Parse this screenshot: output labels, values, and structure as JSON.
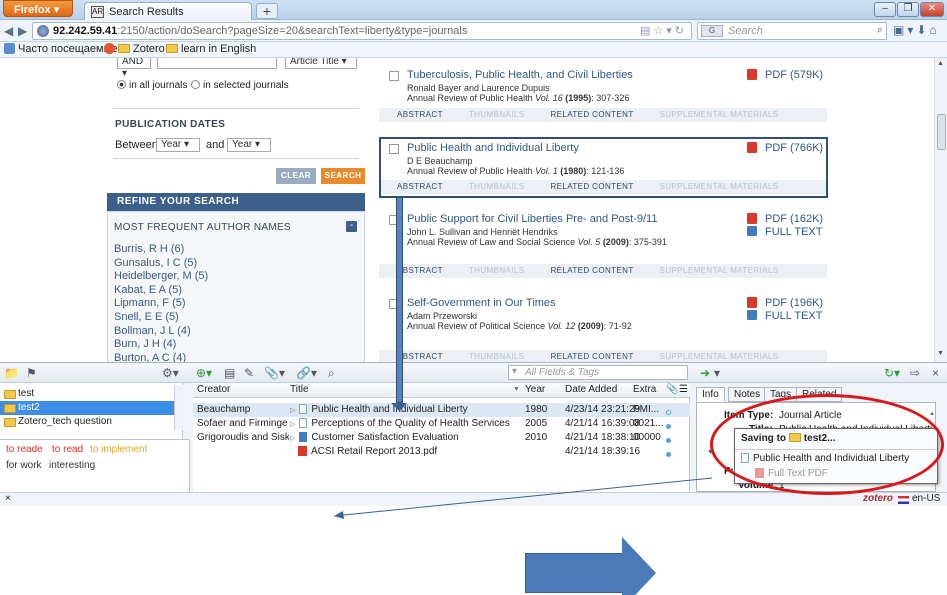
{
  "browser": {
    "app_button": "Firefox",
    "tab_title": "Search Results",
    "new_tab": "+",
    "url_host": "92.242.59.41",
    "url_rest": ":2150/action/doSearch?pageSize=20&searchText=liberty&type=journals",
    "search_placeholder": "Search",
    "search_engine": "G",
    "bookmarks": [
      {
        "label": "Часто посещаемые"
      },
      {
        "label": "Zotero"
      },
      {
        "label": "learn in English"
      }
    ]
  },
  "page": {
    "field_operator": "AND",
    "field_type": "Article Title",
    "scope_all": "in all journals",
    "scope_selected": "in selected journals",
    "dates_heading": "PUBLICATION DATES",
    "between": "Between",
    "year_from": "Year",
    "and": "and",
    "year_to": "Year",
    "clear_label": "CLEAR",
    "search_label": "SEARCH",
    "refine_heading": "REFINE YOUR SEARCH",
    "authors_heading": "MOST FREQUENT AUTHOR NAMES",
    "collapse": "-",
    "authors": [
      "Burris, R H (6)",
      "Gunsalus, I C (5)",
      "Heidelberger, M (5)",
      "Kabat, E A (5)",
      "Lipmann, F (5)",
      "Snell, E E (5)",
      "Bollman, J L (4)",
      "Burn, J H (4)",
      "Burton, A C (4)"
    ],
    "result_tabs": [
      "ABSTRACT",
      "THUMBNAILS",
      "RELATED CONTENT",
      "SUPPLEMENTAL MATERIALS"
    ],
    "results": [
      {
        "title": "Tuberculosis, Public Health, and Civil Liberties",
        "authors": "Ronald Bayer and Laurence Dupuis",
        "cite_pre": "Annual Review of Public Health ",
        "cite_vol": "Vol. 16",
        "cite_year": "(1995)",
        "cite_pages": ": 307-326",
        "pdf": "PDF (579K)",
        "full": ""
      },
      {
        "title": "Public Health and Individual Liberty",
        "authors": "D E Beauchamp",
        "cite_pre": "Annual Review of Public Health ",
        "cite_vol": "Vol. 1",
        "cite_year": "(1980)",
        "cite_pages": ": 121-136",
        "pdf": "PDF (766K)",
        "full": ""
      },
      {
        "title": "Public Support for Civil Liberties Pre- and Post-9/11",
        "authors": "John L. Sullivan and Henriët Hendriks",
        "cite_pre": "Annual Review of Law and Social Science ",
        "cite_vol": "Vol. 5",
        "cite_year": "(2009)",
        "cite_pages": ": 375-391",
        "pdf": "PDF (162K)",
        "full": "FULL TEXT"
      },
      {
        "title": "Self-Government in Our Times",
        "authors": "Adam Przeworski",
        "cite_pre": "Annual Review of Political Science ",
        "cite_vol": "Vol. 12",
        "cite_year": "(2009)",
        "cite_pages": ": 71-92",
        "pdf": "PDF (196K)",
        "full": "FULL TEXT"
      }
    ]
  },
  "zotero": {
    "search_placeholder": "All Fields & Tags",
    "collections": [
      "test",
      "test2",
      "Zotero_tech question"
    ],
    "tags": [
      "to reade",
      "to read",
      "to implement",
      "for work",
      "interesting"
    ],
    "columns": {
      "creator": "Creator",
      "title": "Title",
      "year": "Year",
      "date_added": "Date Added",
      "extra": "Extra"
    },
    "items": [
      {
        "creator": "Beauchamp",
        "title": "Public Health and Individual Liberty",
        "year": "1980",
        "date": "4/23/14 23:21:29",
        "extra": "PMI..."
      },
      {
        "creator": "Sofaer and Firminger",
        "title": "Perceptions of the Quality of Health Services",
        "year": "2005",
        "date": "4/21/14 16:39:08",
        "extra": "0021..."
      },
      {
        "creator": "Grigoroudis and Siskos",
        "title": "Customer Satisfaction Evaluation",
        "year": "2010",
        "date": "4/21/14 18:38:10",
        "extra": "00000"
      },
      {
        "creator": "",
        "title": "ACSI Retail Report 2013.pdf",
        "year": "",
        "date": "4/21/14 18:39:16",
        "extra": ""
      }
    ],
    "tabs": [
      "Info",
      "Notes",
      "Tags",
      "Related"
    ],
    "info": {
      "item_type_label": "Item Type:",
      "item_type": "Journal Article",
      "title_label": "Title:",
      "title": "Public Health and Individual Liberty",
      "a_label": "A",
      "pub_label": "Pub",
      "volume_label": "Volume:",
      "volume": "1"
    },
    "popup": {
      "saving_to": "Saving to",
      "folder": "test2...",
      "item": "Public Health and Individual Liberty",
      "attachment": "Full Text PDF"
    },
    "status_close": "×",
    "brand": "zotero",
    "locale": "en-US"
  },
  "colors": {
    "accent_blue": "#3c5f8c",
    "link_blue": "#2f5789",
    "highlight_red": "#d9161a",
    "zotero_selection": "#3d8ee5"
  }
}
